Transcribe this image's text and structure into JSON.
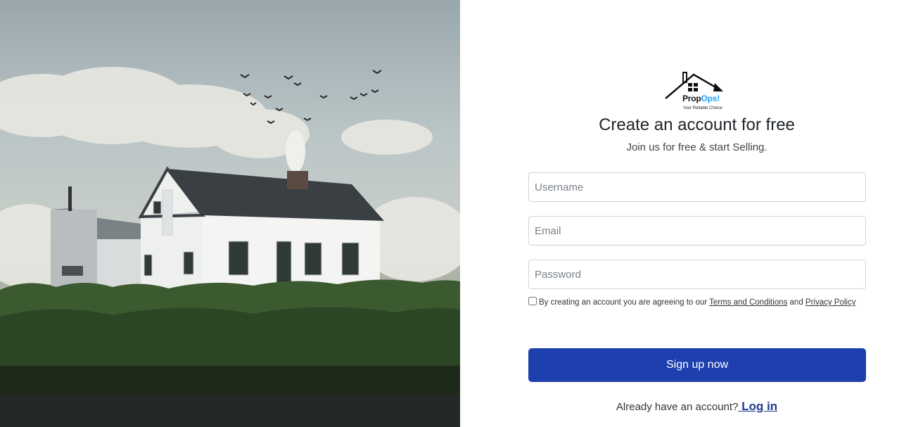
{
  "hero": {
    "image": "farmhouse-landscape"
  },
  "logo": {
    "name_part1": "Prop",
    "name_part2": "Ops!",
    "tagline": "Your Reliable Choice",
    "icon": "house-logo-icon"
  },
  "form": {
    "title": "Create an account for free",
    "subtitle": "Join us for free & start Selling.",
    "username_placeholder": "Username",
    "email_placeholder": "Email",
    "password_placeholder": "Password",
    "terms_prefix": "By creating an account you are agreeing to our ",
    "terms_link": "Terms and Conditions",
    "terms_and": " and ",
    "privacy_link": "Privacy Policy",
    "terms_checked": false,
    "submit_label": "Sign up now",
    "login_prompt": "Already have an account?",
    "login_link": " Log in"
  },
  "colors": {
    "primary": "#1e40af",
    "accent": "#1ea1f2"
  }
}
